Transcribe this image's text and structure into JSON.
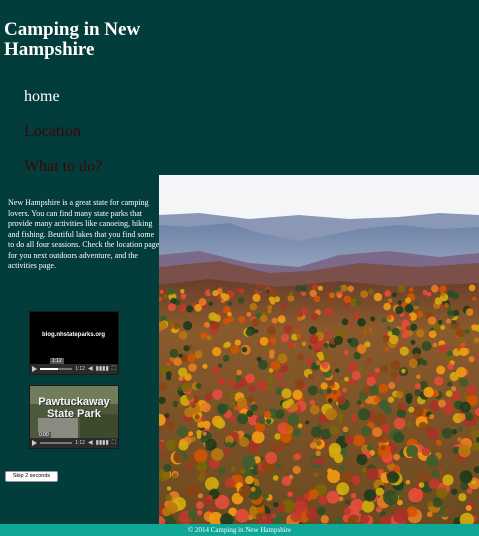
{
  "header": {
    "title": "Camping in New Hampshire"
  },
  "nav": {
    "items": [
      {
        "label": "home"
      },
      {
        "label": "Location"
      },
      {
        "label": "What to do?"
      }
    ]
  },
  "intro": {
    "text": "New Hampshire is a great state for camping lovers. You can find many state parks that provide many activities like canoeing, hiking and fishing. Beutiful lakes that you find some to do all four seasions. Check the location page for you next outdoors adventure, and the activities page."
  },
  "videos": [
    {
      "overlay_text": "blog.nhstateparks.org",
      "time_tooltip": "1:12",
      "time": "1:12",
      "progress": 0.55
    },
    {
      "overlay_text": "Pawtuckaway State Park",
      "time_tooltip": "0:00",
      "time": "1:12",
      "progress": 0.0
    }
  ],
  "skip_button": {
    "label": "Skip 2 seconds"
  },
  "footer": {
    "text": "© 2014 Camping in New Hampshire"
  },
  "colors": {
    "background": "#033d3b",
    "footer": "#0fa898",
    "nav_dim": "#3a0606"
  }
}
